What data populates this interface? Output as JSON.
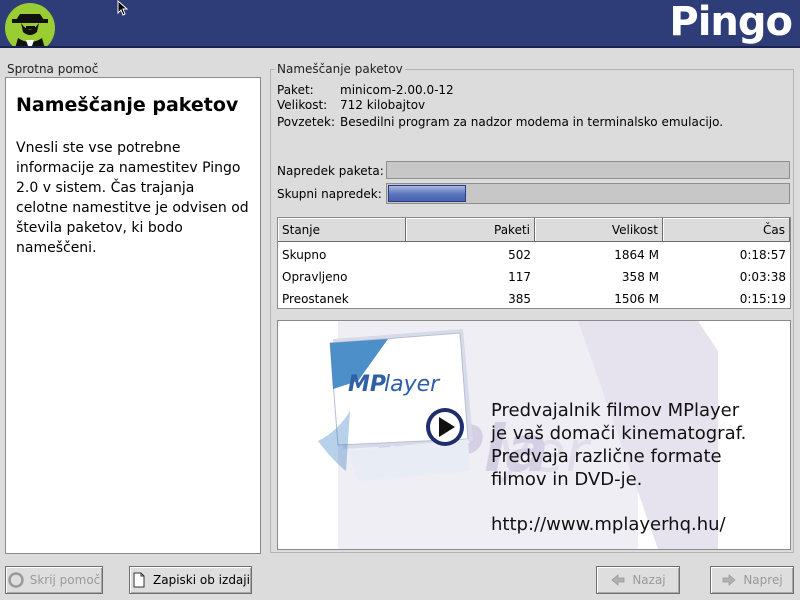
{
  "header": {
    "product_name": "Pingo",
    "logo_icon": "shadowman-logo-icon",
    "background_color": "#2e3d77"
  },
  "help": {
    "section_label": "Sprotna pomoč",
    "heading": "Nameščanje paketov",
    "body": "Vnesli ste vse potrebne informacije za namestitev Pingo 2.0 v sistem. Čas trajanja celotne namestitve je odvisen od števila paketov, ki bodo nameščeni."
  },
  "install": {
    "section_label": "Nameščanje paketov",
    "package_key": "Paket:",
    "package_value": "minicom-2.00.0-12",
    "size_key": "Velikost:",
    "size_value": "712 kilobajtov",
    "summary_key": "Povzetek:",
    "summary_value": "Besedilni program za nadzor modema in terminalsko emulacijo.",
    "package_progress_label": "Napredek paketa:",
    "package_progress_fraction": 0.0,
    "total_progress_label": "Skupni napredek:",
    "total_progress_fraction": 0.195,
    "progress_color": "#5a73bd"
  },
  "stats": {
    "headers": [
      "Stanje",
      "Paketi",
      "Velikost",
      "Čas"
    ],
    "rows": [
      [
        "Skupno",
        "502",
        "1864 M",
        "0:18:57"
      ],
      [
        "Opravljeno",
        "117",
        "358 M",
        "0:03:38"
      ],
      [
        "Preostanek",
        "385",
        "1506 M",
        "0:15:19"
      ]
    ]
  },
  "ad": {
    "logo_text": "MPlayer",
    "lines": [
      "Predvajalnik filmov MPlayer",
      "je vaš domači kinematograf.",
      "Predvaja različne formate",
      "filmov in DVD-je."
    ],
    "url": "http://www.mplayerhq.hu/",
    "accent_color": "#2e7cc0"
  },
  "buttons": {
    "hide_help": "Skrij pomoč",
    "release_notes": "Zapiski ob izdaji",
    "back": "Nazaj",
    "next": "Naprej"
  }
}
